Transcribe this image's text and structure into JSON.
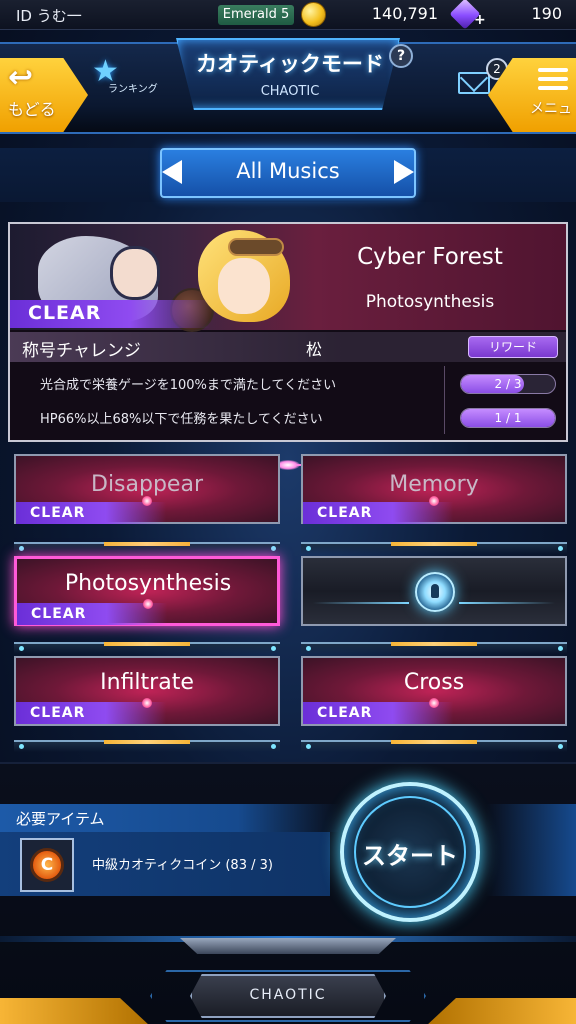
{
  "status_bar": {
    "player_id": "ID  うむ一",
    "rank": "Emerald 5",
    "coins": "140,791",
    "gems": "190"
  },
  "header": {
    "title": "カオティックモード",
    "subtitle": "CHAOTIC",
    "back_label": "もどる",
    "menu_label": "メニュ",
    "ranking_label": "ランキング",
    "mail_count": "2",
    "help": "?"
  },
  "selector": {
    "label": "All Musics"
  },
  "selected_song": {
    "title": "Cyber Forest",
    "subtitle": "Photosynthesis",
    "status": "CLEAR",
    "challenge_label": "称号チャレンジ",
    "challenge_tier": "松",
    "reward_label": "リワード",
    "missions": [
      {
        "text": "光合成で栄養ゲージを100%まで満たしてください",
        "progress": "2 / 3",
        "fraction": 0.67
      },
      {
        "text": "HP66%以上68%以下で任務を果たしてください",
        "progress": "1 / 1",
        "fraction": 1.0
      }
    ]
  },
  "songs": [
    {
      "name": "Disappear",
      "status": "CLEAR"
    },
    {
      "name": "Memory",
      "status": "CLEAR"
    },
    {
      "name": "Photosynthesis",
      "status": "CLEAR"
    },
    {
      "name": "",
      "status": "locked"
    },
    {
      "name": "Infiltrate",
      "status": "CLEAR"
    },
    {
      "name": "Cross",
      "status": "CLEAR"
    }
  ],
  "bottom": {
    "required_label": "必要アイテム",
    "item_name": "中級カオティクコイン (83 / 3)",
    "item_icon_letter": "C",
    "start_label": "スタート",
    "mode_tab": "CHAOTIC"
  },
  "colors": {
    "accent_gold": "#f7b536",
    "clear_purple": "#8f4bf0",
    "song_card_red": "#c02357",
    "neon_blue": "#4fd6ff"
  }
}
